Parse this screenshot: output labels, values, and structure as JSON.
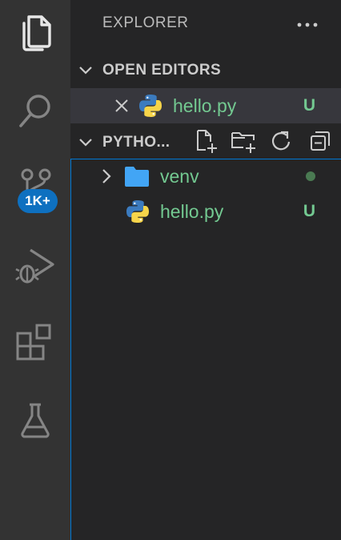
{
  "activity_bar": {
    "items": [
      {
        "name": "explorer",
        "icon": "files-icon",
        "active": true
      },
      {
        "name": "search",
        "icon": "search-icon",
        "active": false
      },
      {
        "name": "source-control",
        "icon": "source-control-icon",
        "active": false,
        "badge": "1K+"
      },
      {
        "name": "run-and-debug",
        "icon": "run-debug-icon",
        "active": false
      },
      {
        "name": "extensions",
        "icon": "extensions-icon",
        "active": false
      },
      {
        "name": "testing",
        "icon": "flask-icon",
        "active": false
      }
    ],
    "badge_color": "#0e70c0"
  },
  "sidebar": {
    "title": "EXPLORER",
    "more_icon": "ellipsis-icon",
    "open_editors": {
      "label": "OPEN EDITORS",
      "files": [
        {
          "name": "hello.py",
          "status": "U",
          "icon": "python-icon",
          "close_icon": "close-icon"
        }
      ]
    },
    "folder": {
      "label": "PYTHO...",
      "actions": [
        {
          "name": "new-file",
          "icon": "new-file-icon"
        },
        {
          "name": "new-folder",
          "icon": "new-folder-icon"
        },
        {
          "name": "refresh",
          "icon": "refresh-icon"
        },
        {
          "name": "collapse-all",
          "icon": "collapse-all-icon"
        }
      ],
      "items": [
        {
          "type": "folder",
          "name": "venv",
          "icon": "folder-icon",
          "expanded": false,
          "decoration": "dot"
        },
        {
          "type": "file",
          "name": "hello.py",
          "icon": "python-icon",
          "status": "U"
        }
      ]
    }
  },
  "colors": {
    "untracked": "#73c991",
    "focus_border": "#0078d4",
    "folder": "#42a5f5"
  }
}
